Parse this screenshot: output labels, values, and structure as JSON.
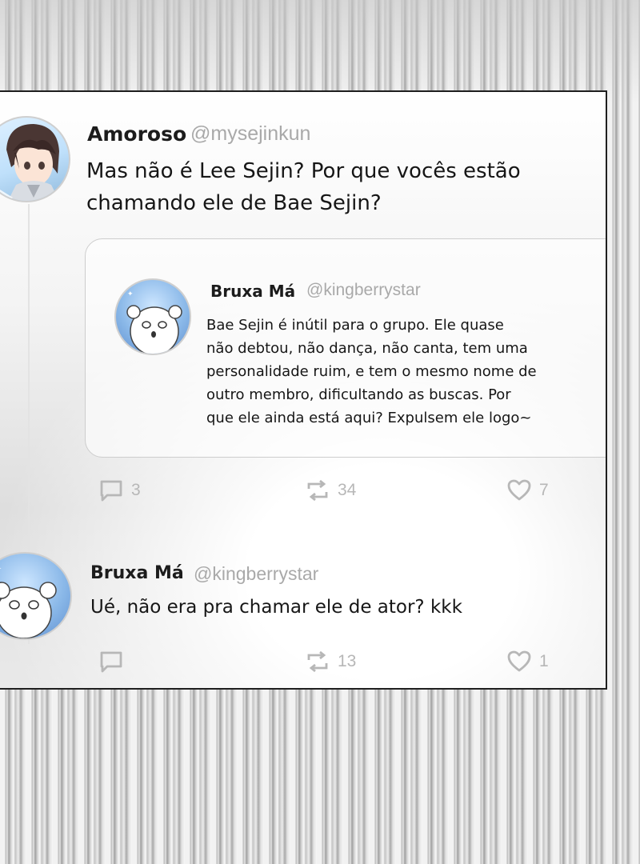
{
  "tweet": {
    "author_name": "Amoroso",
    "author_handle": "@mysejinkun",
    "text_line1": "Mas não é Lee Sejin? Por que vocês estão",
    "text_line2": "chamando ele de Bae Sejin?",
    "avatar_icon": "anime-boy-avatar",
    "quoted": {
      "author_name": "Bruxa Má",
      "author_handle": "@kingberrystar",
      "avatar_icon": "bear-avatar",
      "lines": [
        "Bae Sejin é inútil para o grupo. Ele quase",
        "não debtou, não dança, não canta, tem uma",
        "personalidade ruim, e tem o mesmo nome de",
        "outro membro, dificultando as buscas. Por",
        "que ele ainda está aqui? Expulsem ele logo~"
      ]
    },
    "actions": {
      "comments": "3",
      "retweets": "34",
      "likes": "7"
    }
  },
  "reply": {
    "author_name": "Bruxa Má",
    "author_handle": "@kingberrystar",
    "avatar_icon": "bear-avatar",
    "text": "Ué, não era pra chamar ele de ator? kkk",
    "actions": {
      "comments": "",
      "retweets": "13",
      "likes": "1"
    }
  },
  "colors": {
    "text": "#161616",
    "handle": "#a9a9a9",
    "icon": "#b7b7b7",
    "border": "#1f1f1f"
  }
}
